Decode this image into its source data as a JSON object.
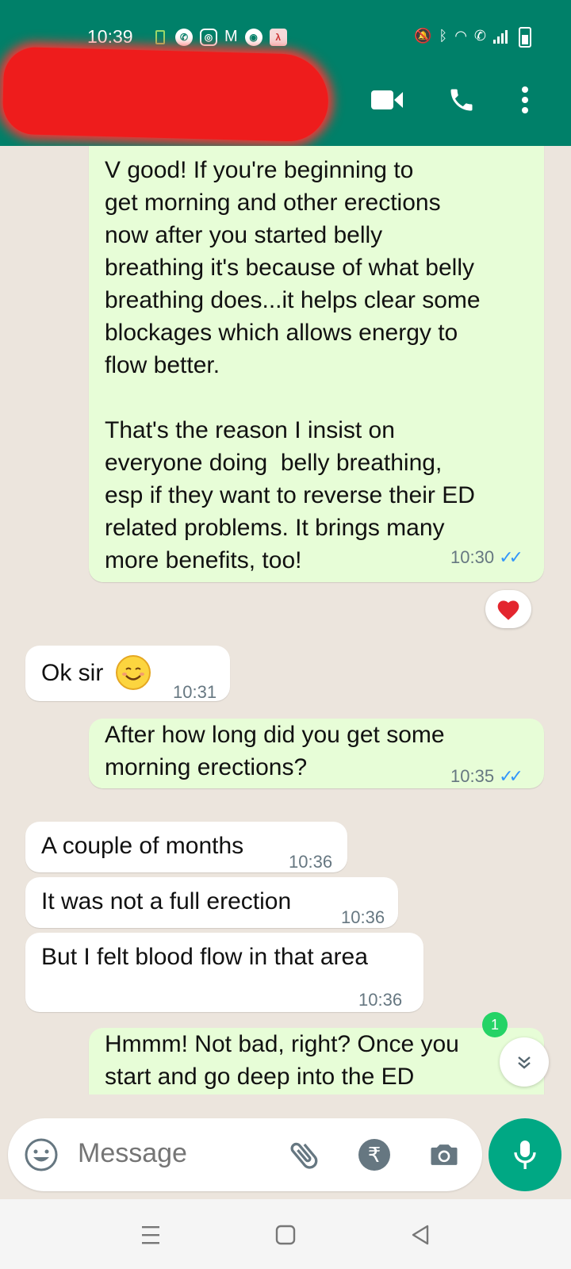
{
  "status_bar": {
    "time": "10:39"
  },
  "messages": [
    {
      "id": "m1",
      "direction": "out",
      "text": "V good! If you're beginning to\nget morning and other erections\nnow after you started belly\nbreathing it's because of what belly\nbreathing does...it helps clear some\nblockages which allows energy to\nflow better.\n\nThat's the reason I insist on\neveryone doing  belly breathing,\nesp if they want to reverse their ED\nrelated problems. It brings many\nmore benefits, too!",
      "time": "10:30",
      "read": true,
      "reaction": "heart"
    },
    {
      "id": "m2",
      "direction": "in",
      "text": "Ok sir",
      "emoji": "smiling-face",
      "time": "10:31"
    },
    {
      "id": "m3",
      "direction": "out",
      "text": "After how long did you get some\nmorning erections?",
      "time": "10:35",
      "read": true
    },
    {
      "id": "m4",
      "direction": "in",
      "text": "A couple of months",
      "time": "10:36"
    },
    {
      "id": "m5",
      "direction": "in",
      "text": "It was not a full erection",
      "time": "10:36"
    },
    {
      "id": "m6",
      "direction": "in",
      "text": "But I felt blood flow in that area",
      "time": "10:36"
    },
    {
      "id": "m7",
      "direction": "out",
      "text": "Hmmm! Not bad, right? Once you\nstart and go deep into the ED"
    }
  ],
  "unread_count": "1",
  "composer": {
    "placeholder": "Message",
    "currency_symbol": "₹"
  },
  "colors": {
    "header": "#008069",
    "outgoing_bubble": "#e7fdd7",
    "incoming_bubble": "#ffffff",
    "read_ticks": "#3497f9",
    "mic_button": "#00a884"
  }
}
